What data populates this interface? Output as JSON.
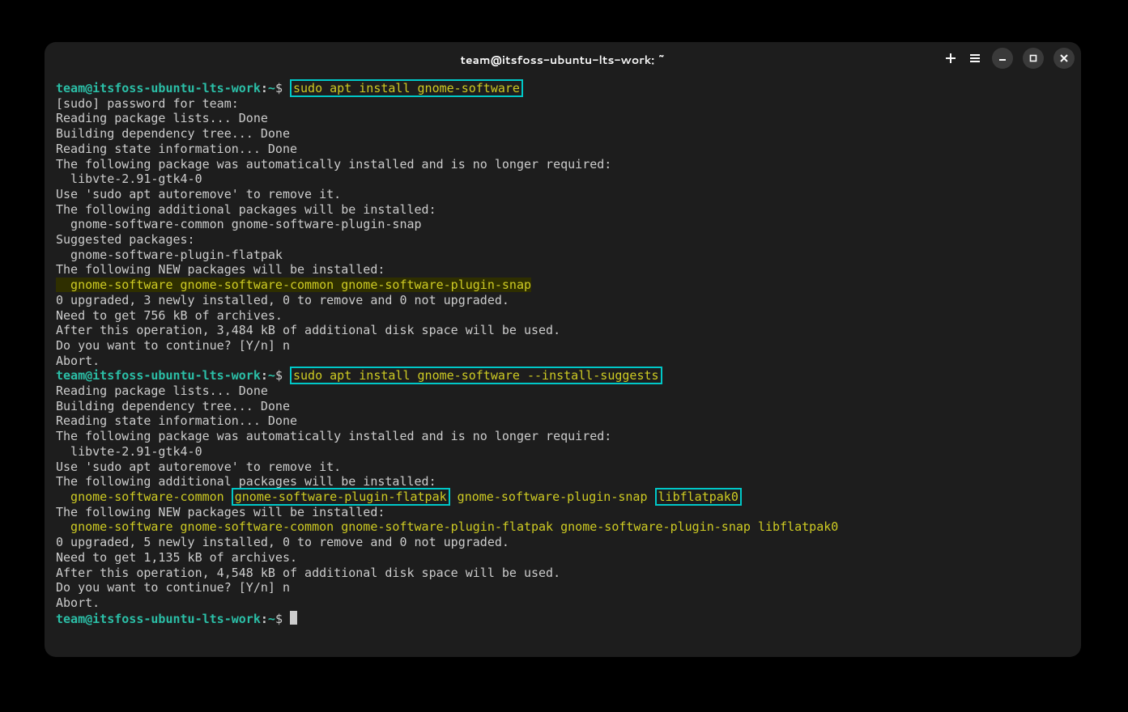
{
  "window": {
    "title": "team@itsfoss-ubuntu-lts-work: ~"
  },
  "prompt": {
    "user_host": "team@itsfoss-ubuntu-lts-work",
    "sep": ":",
    "path": "~",
    "dollar": "$"
  },
  "commands": {
    "cmd1": "sudo apt install gnome-software",
    "cmd2": "sudo apt install gnome-software --install-suggests"
  },
  "block1": {
    "l1": "[sudo] password for team: ",
    "l2": "Reading package lists... Done",
    "l3": "Building dependency tree... Done",
    "l4": "Reading state information... Done",
    "l5": "The following package was automatically installed and is no longer required:",
    "l6": "  libvte-2.91-gtk4-0",
    "l7": "Use 'sudo apt autoremove' to remove it.",
    "l8": "The following additional packages will be installed:",
    "l9": "  gnome-software-common gnome-software-plugin-snap",
    "l10": "Suggested packages:",
    "l11": "  gnome-software-plugin-flatpak",
    "l12": "The following NEW packages will be installed:",
    "l13": "  gnome-software gnome-software-common gnome-software-plugin-snap",
    "l14": "0 upgraded, 3 newly installed, 0 to remove and 0 not upgraded.",
    "l15": "Need to get 756 kB of archives.",
    "l16": "After this operation, 3,484 kB of additional disk space will be used.",
    "l17": "Do you want to continue? [Y/n] n",
    "l18": "Abort."
  },
  "block2": {
    "l1": "Reading package lists... Done",
    "l2": "Building dependency tree... Done",
    "l3": "Reading state information... Done",
    "l4": "The following package was automatically installed and is no longer required:",
    "l5": "  libvte-2.91-gtk4-0",
    "l6": "Use 'sudo apt autoremove' to remove it.",
    "l7": "The following additional packages will be installed:",
    "pkgs_pre": "  gnome-software-common ",
    "box1": "gnome-software-plugin-flatpak",
    "pkgs_mid": " gnome-software-plugin-snap ",
    "box2": "libflatpak0",
    "l9": "The following NEW packages will be installed:",
    "l10": "  gnome-software gnome-software-common gnome-software-plugin-flatpak gnome-software-plugin-snap libflatpak0",
    "l11": "0 upgraded, 5 newly installed, 0 to remove and 0 not upgraded.",
    "l12": "Need to get 1,135 kB of archives.",
    "l13": "After this operation, 4,548 kB of additional disk space will be used.",
    "l14": "Do you want to continue? [Y/n] n",
    "l15": "Abort."
  }
}
